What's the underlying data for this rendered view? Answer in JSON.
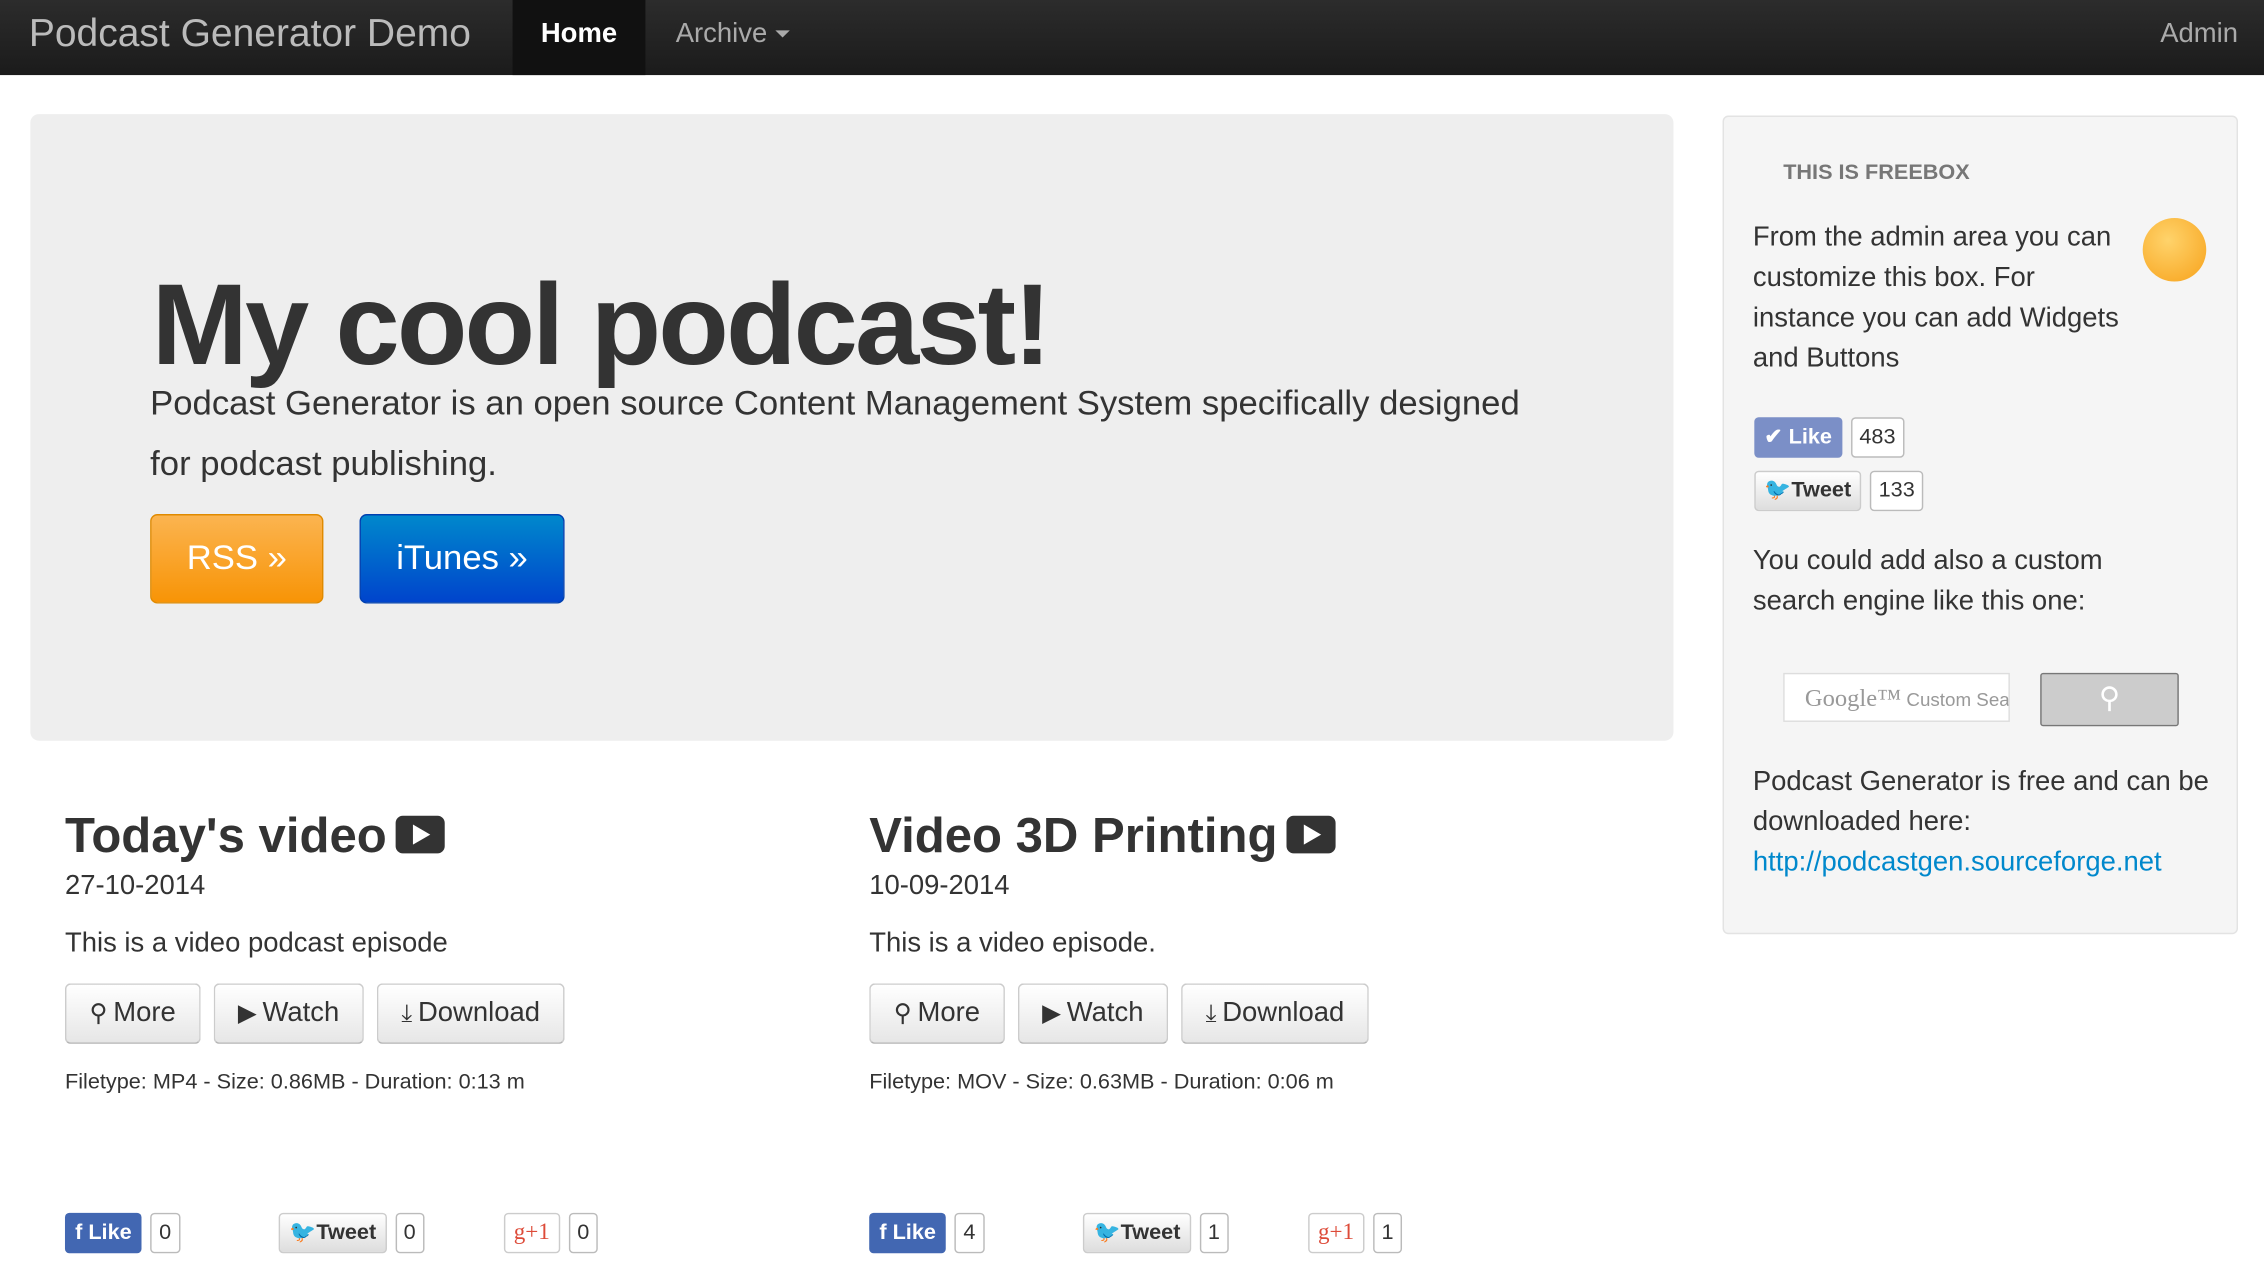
{
  "navbar": {
    "brand": "Podcast Generator Demo",
    "items": [
      {
        "label": "Home",
        "active": true
      },
      {
        "label": "Archive",
        "dropdown": true
      }
    ],
    "admin": "Admin"
  },
  "hero": {
    "title": "My cool podcast!",
    "lead": "Podcast Generator is an open source Content Management System specifically designed for podcast publishing.",
    "rss_label": "RSS »",
    "itunes_label": "iTunes »",
    "colors": {
      "rss": "#f89406",
      "itunes": "#0044cc"
    }
  },
  "freebox": {
    "heading": "THIS IS FREEBOX",
    "intro": "From the admin area you can customize this box. For instance you can add Widgets and Buttons",
    "like_label": "Like",
    "like_count": "483",
    "tweet_label": "Tweet",
    "tweet_count": "133",
    "search_text": "You could add also a custom search engine like this one:",
    "search_placeholder_brand": "Google™",
    "search_placeholder": "Custom Search",
    "outro": "Podcast Generator is free and can be downloaded here:",
    "link": "http://podcastgen.sourceforge.net"
  },
  "buttons": {
    "more": "More",
    "watch": "Watch",
    "download": "Download"
  },
  "episodes": [
    {
      "title": "Today's video",
      "date": "27-10-2014",
      "description": "This is a video podcast episode",
      "meta": "Filetype: MP4 - Size: 0.86MB - Duration: 0:13 m",
      "social": {
        "like": "Like",
        "like_count": "0",
        "tweet": "Tweet",
        "tweet_count": "0",
        "gplus": "+1",
        "gplus_count": "0"
      }
    },
    {
      "title": "Video 3D Printing",
      "date": "10-09-2014",
      "description": "This is a video episode.",
      "meta": "Filetype: MOV - Size: 0.63MB - Duration: 0:06 m",
      "social": {
        "like": "Like",
        "like_count": "4",
        "tweet": "Tweet",
        "tweet_count": "1",
        "gplus": "+1",
        "gplus_count": "1"
      }
    }
  ]
}
